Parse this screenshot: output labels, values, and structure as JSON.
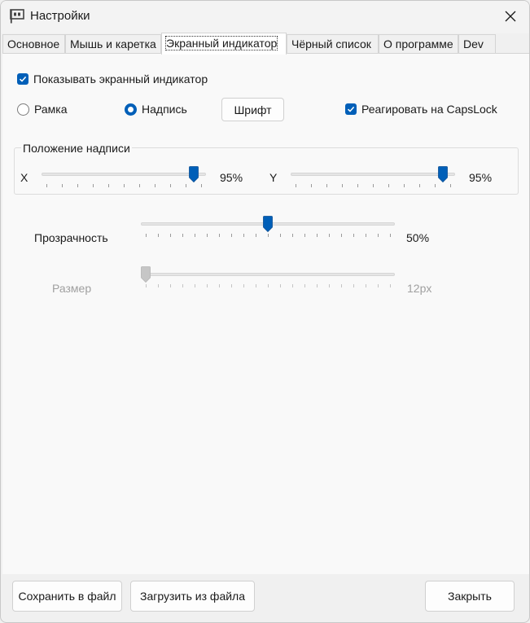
{
  "window": {
    "title": "Настройки"
  },
  "tabs": [
    "Основное",
    "Мышь и каретка",
    "Экранный индикатор",
    "Чёрный список",
    "О программе",
    "Dev"
  ],
  "active_tab": "Экранный индикатор",
  "indicator": {
    "show_label": "Показывать экранный индикатор",
    "show_checked": true,
    "radio_frame": "Рамка",
    "radio_text": "Надпись",
    "selected": "Надпись",
    "font_button": "Шрифт",
    "capslock_label": "Реагировать на CapsLock",
    "capslock_checked": true
  },
  "position_group": {
    "title": "Положение надписи",
    "x_label": "X",
    "x_value": "95%",
    "x_percent": 95,
    "y_label": "Y",
    "y_value": "95%",
    "y_percent": 95
  },
  "transparency": {
    "label": "Прозрачность",
    "value": "50%",
    "percent": 50
  },
  "size": {
    "label": "Размер",
    "value": "12px",
    "fraction": 0,
    "enabled": false
  },
  "buttons": {
    "save": "Сохранить в файл",
    "load": "Загрузить из файла",
    "close": "Закрыть"
  },
  "colors": {
    "accent": "#005fb8",
    "window_bg": "#f0f0f0",
    "panel_bg": "#f9f9f9"
  },
  "icons": {
    "app": "flag-icon",
    "close": "close-icon",
    "check": "checkmark-icon"
  }
}
